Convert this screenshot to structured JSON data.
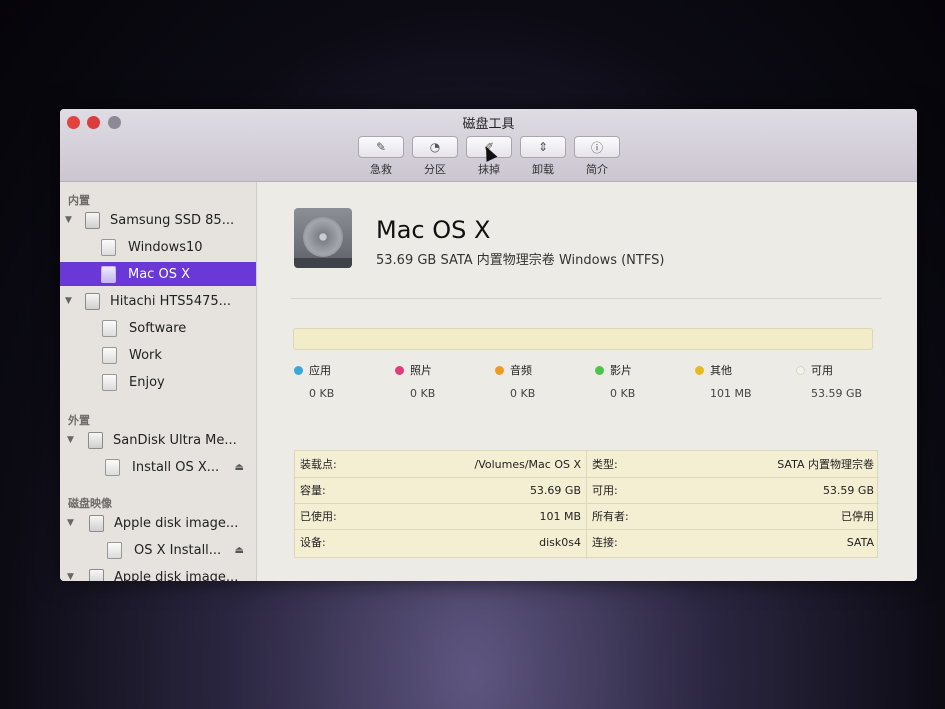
{
  "window": {
    "title": "磁盘工具"
  },
  "toolbar": {
    "items": [
      {
        "label": "急救",
        "icon": "stethoscope-icon",
        "glyph": "✎"
      },
      {
        "label": "分区",
        "icon": "pie-icon",
        "glyph": "◔"
      },
      {
        "label": "抹掉",
        "icon": "erase-icon",
        "glyph": "✐"
      },
      {
        "label": "卸载",
        "icon": "unmount-icon",
        "glyph": "⇕"
      },
      {
        "label": "简介",
        "icon": "info-icon",
        "glyph": "ⓘ"
      }
    ]
  },
  "sidebar": {
    "sections": [
      "内置",
      "外置",
      "磁盘映像"
    ],
    "items": [
      {
        "label": "Samsung SSD 85...",
        "kind": "disk"
      },
      {
        "label": "Windows10",
        "kind": "volume"
      },
      {
        "label": "Mac OS X",
        "kind": "volume",
        "selected": true
      },
      {
        "label": "Hitachi HTS5475...",
        "kind": "disk"
      },
      {
        "label": "Software",
        "kind": "volume"
      },
      {
        "label": "Work",
        "kind": "volume"
      },
      {
        "label": "Enjoy",
        "kind": "volume"
      },
      {
        "label": "SanDisk Ultra Me...",
        "kind": "disk"
      },
      {
        "label": "Install OS X...",
        "kind": "volume",
        "eject": "⏏"
      },
      {
        "label": "Apple disk image...",
        "kind": "disk"
      },
      {
        "label": "OS X Install...",
        "kind": "volume",
        "eject": "⏏"
      },
      {
        "label": "Apple disk image...",
        "kind": "disk"
      }
    ]
  },
  "volume": {
    "name": "Mac OS X",
    "description": "53.69 GB SATA 内置物理宗卷 Windows (NTFS)"
  },
  "usage": {
    "legend": [
      {
        "label": "应用",
        "value": "0 KB",
        "color": "#3aa6dc"
      },
      {
        "label": "照片",
        "value": "0 KB",
        "color": "#e23a7a"
      },
      {
        "label": "音频",
        "value": "0 KB",
        "color": "#ee9a22"
      },
      {
        "label": "影片",
        "value": "0 KB",
        "color": "#4cc44c"
      },
      {
        "label": "其他",
        "value": "101 MB",
        "color": "#e8b820"
      },
      {
        "label": "可用",
        "value": "53.59 GB",
        "color": "#f4f2ea"
      }
    ]
  },
  "info": {
    "rows": [
      {
        "k1": "装载点:",
        "v1": "/Volumes/Mac OS X",
        "k2": "类型:",
        "v2": "SATA 内置物理宗卷"
      },
      {
        "k1": "容量:",
        "v1": "53.69 GB",
        "k2": "可用:",
        "v2": "53.59 GB"
      },
      {
        "k1": "已使用:",
        "v1": "101 MB",
        "k2": "所有者:",
        "v2": "已停用"
      },
      {
        "k1": "设备:",
        "v1": "disk0s4",
        "k2": "连接:",
        "v2": "SATA"
      }
    ]
  }
}
